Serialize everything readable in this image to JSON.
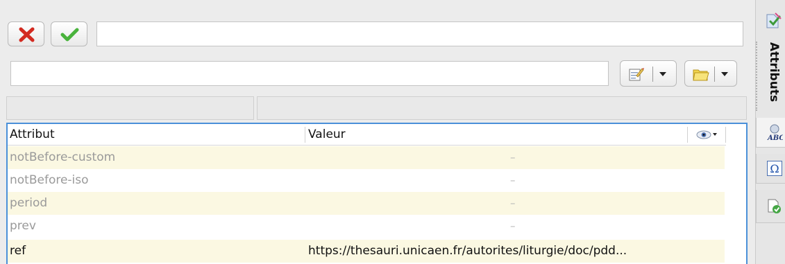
{
  "toolbar": {
    "cancel_icon": "red-x-icon",
    "confirm_icon": "green-check-icon",
    "value_input": "",
    "path_input": "",
    "edit_icon": "edit-pencil-icon",
    "folder_icon": "folder-icon"
  },
  "info_bar": {
    "left": "",
    "right": ""
  },
  "table": {
    "headers": {
      "attribute": "Attribut",
      "value": "Valeur"
    },
    "view_icon": "eye-icon",
    "rows": [
      {
        "attribute": "notBefore-custom",
        "value": "–",
        "set": false
      },
      {
        "attribute": "notBefore-iso",
        "value": "–",
        "set": false
      },
      {
        "attribute": "period",
        "value": "–",
        "set": false
      },
      {
        "attribute": "prev",
        "value": "–",
        "set": false
      },
      {
        "attribute": "ref",
        "value": "https://thesauri.unicaen.fr/autorites/liturgie/doc/pdd...",
        "set": true
      }
    ]
  },
  "side_panel": {
    "tab_label": "Attributs",
    "tools": [
      "spellcheck-icon",
      "omega-symbol-icon",
      "validate-document-icon"
    ]
  },
  "colors": {
    "row_highlight": "#fbf8e2",
    "accent_blue": "#4a90d9",
    "cancel_red": "#d32a20",
    "confirm_green": "#49b33c"
  }
}
